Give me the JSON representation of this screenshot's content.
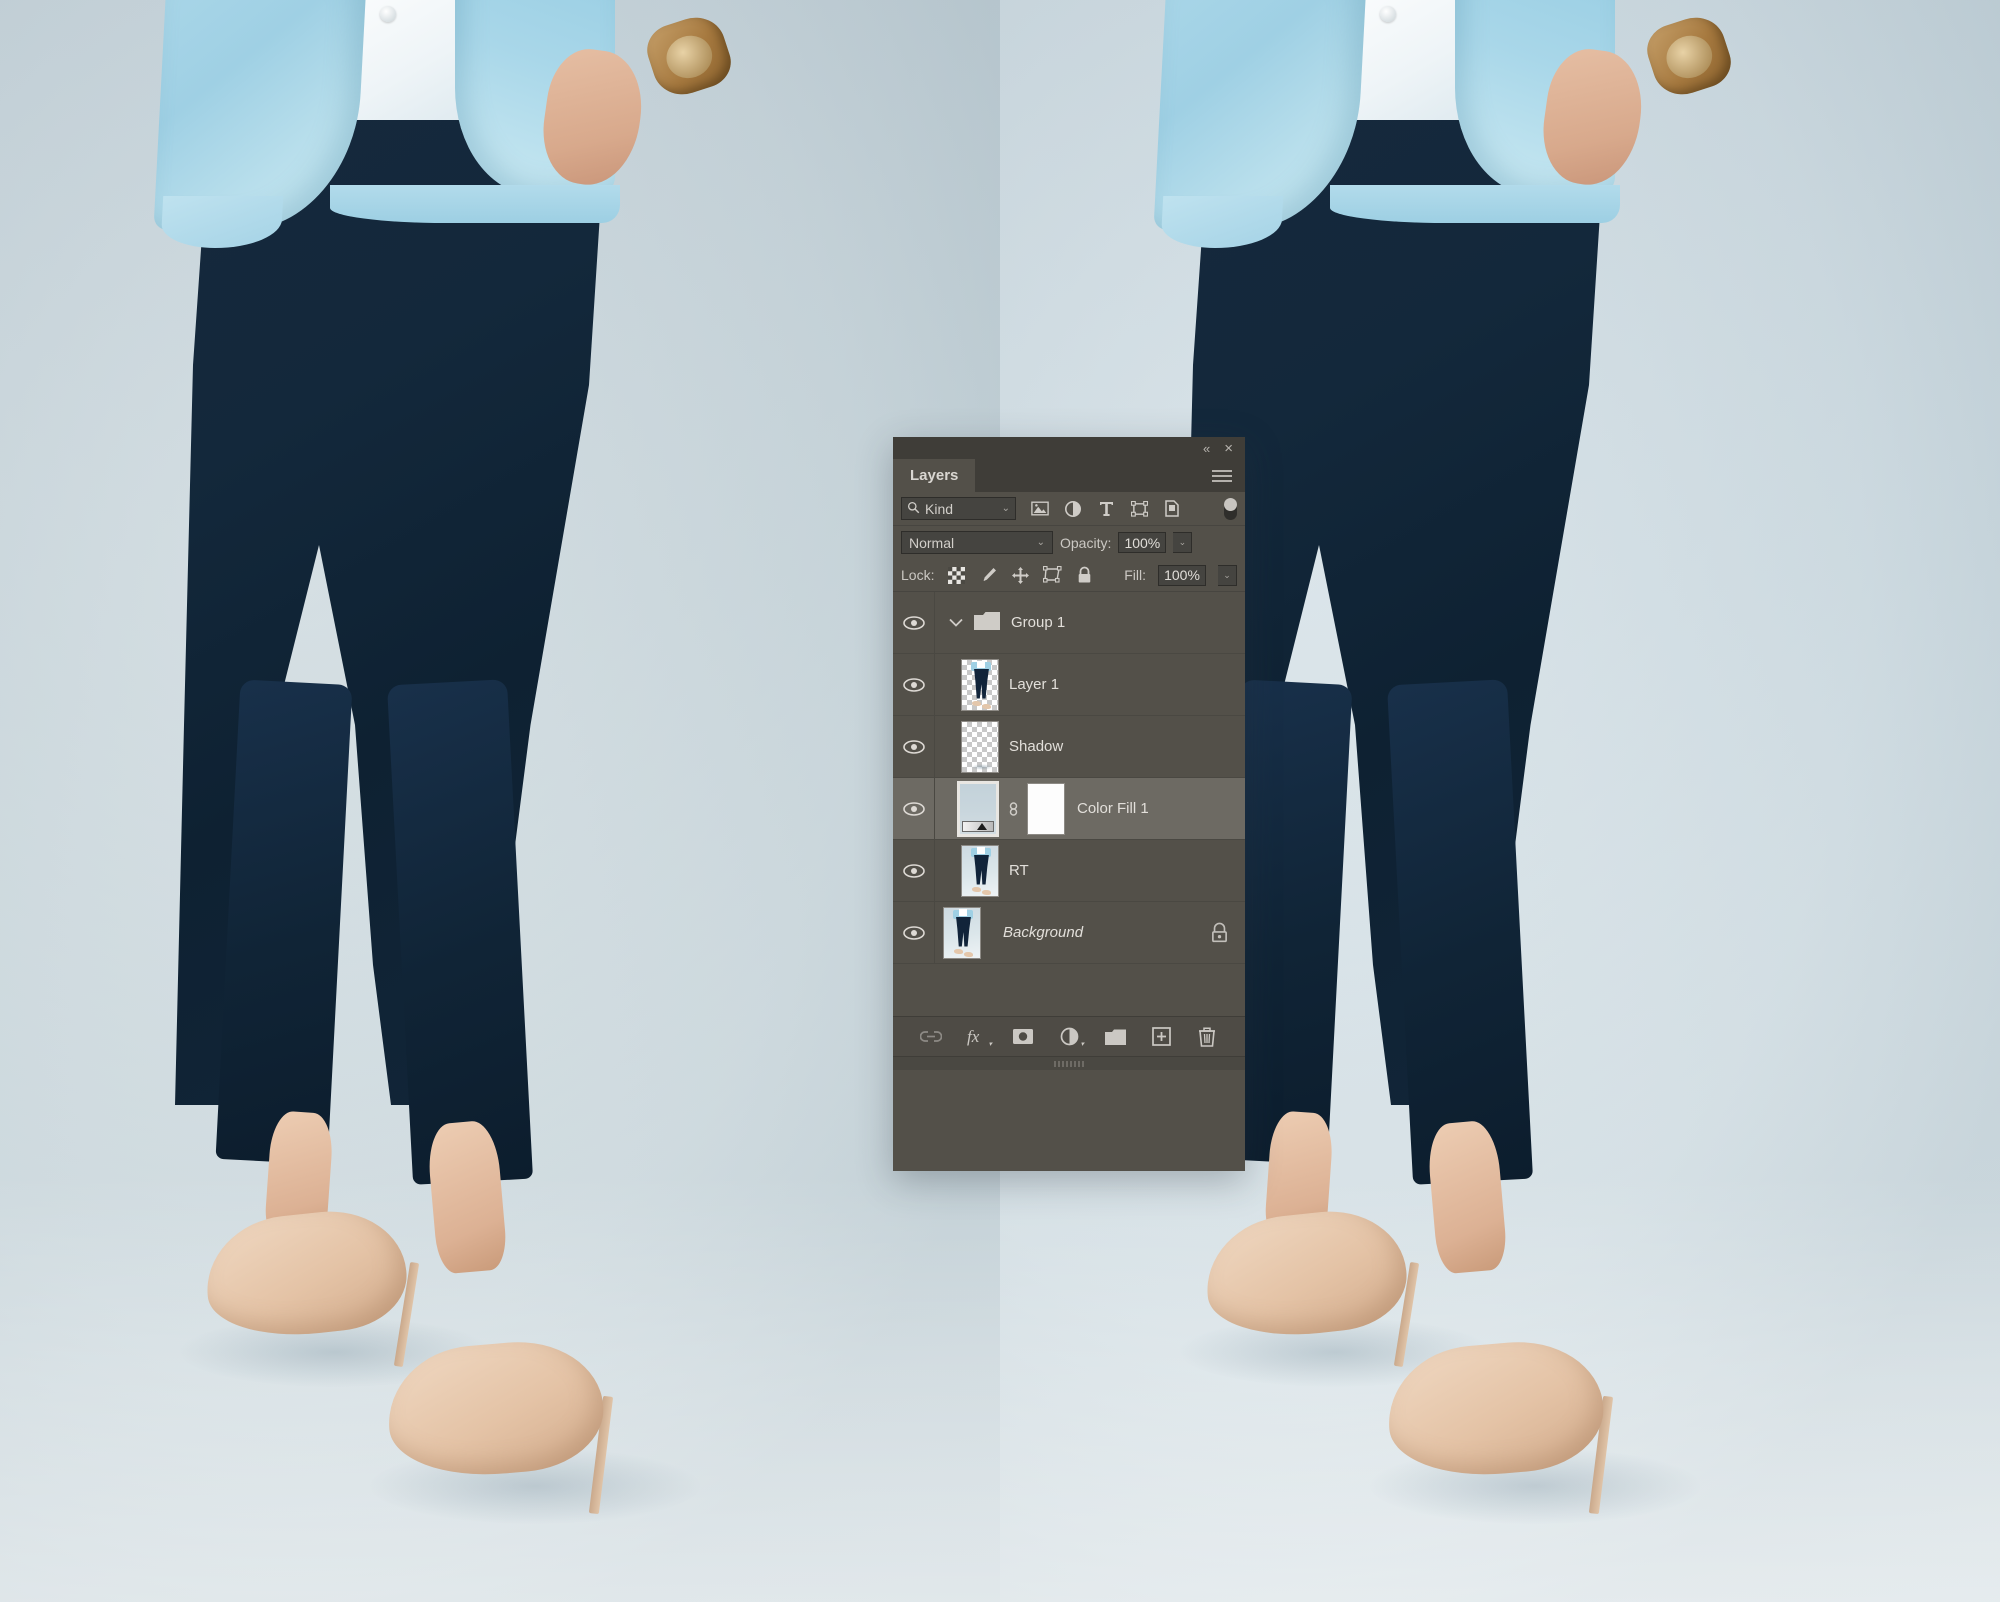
{
  "app": {
    "panel_title": "Layers",
    "collapse_label": "«",
    "close_label": "×"
  },
  "filter_bar": {
    "kind_label": "Kind",
    "search_icon": "search-icon",
    "chevron": "⌄",
    "icons": [
      {
        "name": "filter-pixel-layers-icon",
        "title": "Pixel layers"
      },
      {
        "name": "filter-adjustment-layers-icon",
        "title": "Adjustment layers"
      },
      {
        "name": "filter-type-layers-icon",
        "title": "Type layers"
      },
      {
        "name": "filter-shape-layers-icon",
        "title": "Shape layers"
      },
      {
        "name": "filter-smart-object-icon",
        "title": "Smart objects"
      }
    ],
    "toggle_name": "filter-enable-toggle"
  },
  "blend_bar": {
    "blend_mode": "Normal",
    "opacity_label": "Opacity:",
    "opacity_value": "100%",
    "chevron": "⌄"
  },
  "lock_bar": {
    "lock_label": "Lock:",
    "fill_label": "Fill:",
    "fill_value": "100%",
    "icons": [
      {
        "name": "lock-transparent-pixels-icon"
      },
      {
        "name": "lock-image-pixels-icon"
      },
      {
        "name": "lock-position-icon"
      },
      {
        "name": "lock-artboard-nesting-icon"
      },
      {
        "name": "lock-all-icon"
      }
    ]
  },
  "layers": [
    {
      "name": "Group 1",
      "type": "group",
      "visible": true,
      "selected": false,
      "expanded": true,
      "italic": false,
      "locked": false
    },
    {
      "name": "Layer 1",
      "type": "pixel-transparent",
      "visible": true,
      "selected": false,
      "expanded": null,
      "italic": false,
      "locked": false
    },
    {
      "name": "Shadow",
      "type": "pixel-shadow",
      "visible": true,
      "selected": false,
      "expanded": null,
      "italic": false,
      "locked": false
    },
    {
      "name": "Color Fill 1",
      "type": "fill-with-mask",
      "visible": true,
      "selected": true,
      "expanded": null,
      "italic": false,
      "locked": false
    },
    {
      "name": "RT",
      "type": "pixel-photo",
      "visible": true,
      "selected": false,
      "expanded": null,
      "italic": false,
      "locked": false
    },
    {
      "name": "Background",
      "type": "background",
      "visible": true,
      "selected": false,
      "expanded": null,
      "italic": true,
      "locked": true
    }
  ],
  "footer": {
    "buttons": [
      {
        "name": "link-layers-button",
        "label": "∞",
        "disabled": true
      },
      {
        "name": "layer-styles-button",
        "label": "fx",
        "disabled": false
      },
      {
        "name": "add-layer-mask-button",
        "label": "mask",
        "disabled": false
      },
      {
        "name": "new-adjustment-layer-button",
        "label": "adjust",
        "disabled": false
      },
      {
        "name": "new-group-button",
        "label": "folder",
        "disabled": false
      },
      {
        "name": "new-layer-button",
        "label": "+",
        "disabled": false
      },
      {
        "name": "delete-layer-button",
        "label": "trash",
        "disabled": false
      }
    ]
  },
  "colors": {
    "panel_bg": "#535049",
    "panel_header": "#3f3d38",
    "selected_row": "#6d6a63",
    "text": "#d6d3ce",
    "canvas_left": "#c9d6dd",
    "canvas_right": "#d6e2e8",
    "trousers": "#11243a",
    "shirt": "#9fd0e4",
    "shoe": "#e4c7ab"
  },
  "canvas": {
    "left_image_name": "before-photo",
    "right_image_name": "after-photo"
  }
}
